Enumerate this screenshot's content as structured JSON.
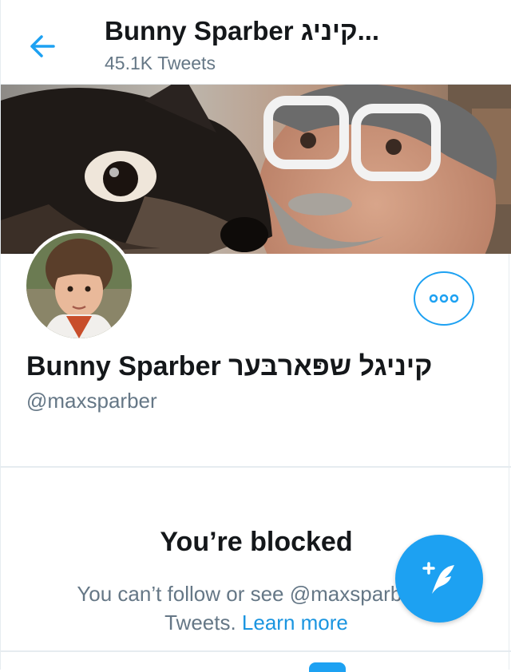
{
  "header": {
    "title": "Bunny Sparber קיניג...",
    "tweet_count": "45.1K Tweets"
  },
  "profile": {
    "display_name": "Bunny Sparber קיניגל שפּארבּער",
    "handle": "@maxsparber"
  },
  "blocked": {
    "title": "You’re blocked",
    "line1": "You can’t follow or see @maxsparber’s",
    "line2_prefix": "Tweets. ",
    "learn_more": "Learn more"
  },
  "icons": {
    "back": "arrow-left-icon",
    "more": "more-options-icon",
    "compose": "compose-tweet-icon"
  },
  "colors": {
    "accent": "#1da1f2",
    "link": "#1b95e0",
    "secondary_text": "#657786",
    "primary_text": "#14171a"
  }
}
